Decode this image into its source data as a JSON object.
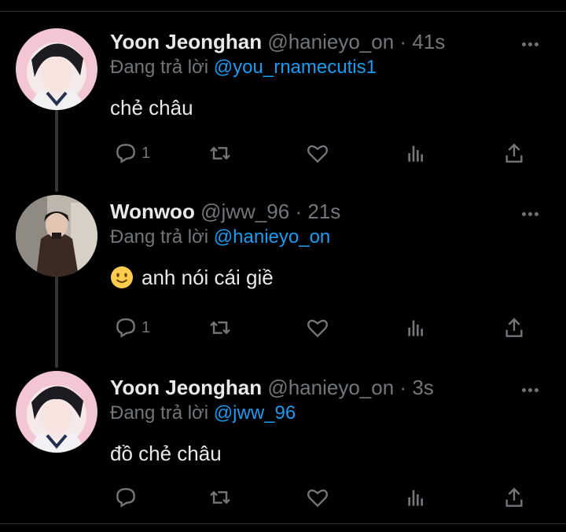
{
  "tweets": [
    {
      "name": "Yoon Jeonghan",
      "handle": "@hanieyo_on",
      "separator": "·",
      "time": "41s",
      "replying_prefix": "Đang trả lời",
      "replying_to": "@you_rnamecutis1",
      "text": "chẻ châu",
      "reply_count": "1",
      "avatar": "jeonghan-avatar-pink"
    },
    {
      "name": "Wonwoo",
      "handle": "@jww_96",
      "separator": "·",
      "time": "21s",
      "replying_prefix": "Đang trả lời",
      "replying_to": "@hanieyo_on",
      "emoji": "slightly-smiling-face",
      "text": "anh nói cái giề",
      "reply_count": "1",
      "avatar": "wonwoo-avatar-street"
    },
    {
      "name": "Yoon Jeonghan",
      "handle": "@hanieyo_on",
      "separator": "·",
      "time": "3s",
      "replying_prefix": "Đang trả lời",
      "replying_to": "@jww_96",
      "text": "đồ chẻ châu",
      "reply_count": "",
      "avatar": "jeonghan-avatar-pink"
    }
  ],
  "colors": {
    "background": "#000000",
    "text": "#e7e9ea",
    "muted": "#71767b",
    "link": "#1d9bf0",
    "thread_line": "#333639"
  },
  "icons": [
    "reply-icon",
    "retweet-icon",
    "like-icon",
    "views-icon",
    "share-icon",
    "more-icon"
  ]
}
